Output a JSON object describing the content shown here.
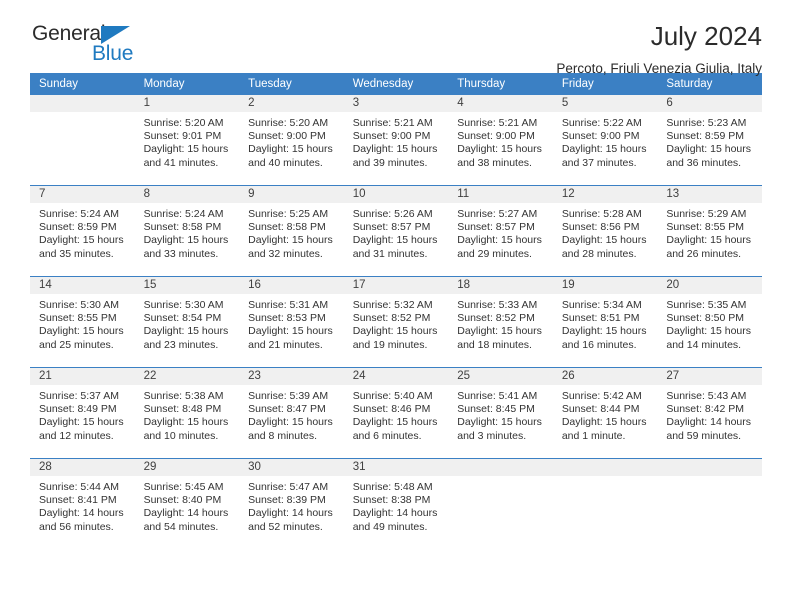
{
  "brand": {
    "word_general": "General",
    "word_blue": "Blue",
    "accent_color": "#1f7ac0"
  },
  "header": {
    "title": "July 2024",
    "subtitle": "Percoto, Friuli Venezia Giulia, Italy",
    "header_bg_color": "#3b80c4",
    "daynum_bg_color": "#f0f0f0"
  },
  "weekday_headers": [
    "Sunday",
    "Monday",
    "Tuesday",
    "Wednesday",
    "Thursday",
    "Friday",
    "Saturday"
  ],
  "weeks": [
    [
      {
        "day": "",
        "sunrise": "",
        "sunset": "",
        "daylight_line1": "",
        "daylight_line2": ""
      },
      {
        "day": "1",
        "sunrise": "Sunrise: 5:20 AM",
        "sunset": "Sunset: 9:01 PM",
        "daylight_line1": "Daylight: 15 hours",
        "daylight_line2": "and 41 minutes."
      },
      {
        "day": "2",
        "sunrise": "Sunrise: 5:20 AM",
        "sunset": "Sunset: 9:00 PM",
        "daylight_line1": "Daylight: 15 hours",
        "daylight_line2": "and 40 minutes."
      },
      {
        "day": "3",
        "sunrise": "Sunrise: 5:21 AM",
        "sunset": "Sunset: 9:00 PM",
        "daylight_line1": "Daylight: 15 hours",
        "daylight_line2": "and 39 minutes."
      },
      {
        "day": "4",
        "sunrise": "Sunrise: 5:21 AM",
        "sunset": "Sunset: 9:00 PM",
        "daylight_line1": "Daylight: 15 hours",
        "daylight_line2": "and 38 minutes."
      },
      {
        "day": "5",
        "sunrise": "Sunrise: 5:22 AM",
        "sunset": "Sunset: 9:00 PM",
        "daylight_line1": "Daylight: 15 hours",
        "daylight_line2": "and 37 minutes."
      },
      {
        "day": "6",
        "sunrise": "Sunrise: 5:23 AM",
        "sunset": "Sunset: 8:59 PM",
        "daylight_line1": "Daylight: 15 hours",
        "daylight_line2": "and 36 minutes."
      }
    ],
    [
      {
        "day": "7",
        "sunrise": "Sunrise: 5:24 AM",
        "sunset": "Sunset: 8:59 PM",
        "daylight_line1": "Daylight: 15 hours",
        "daylight_line2": "and 35 minutes."
      },
      {
        "day": "8",
        "sunrise": "Sunrise: 5:24 AM",
        "sunset": "Sunset: 8:58 PM",
        "daylight_line1": "Daylight: 15 hours",
        "daylight_line2": "and 33 minutes."
      },
      {
        "day": "9",
        "sunrise": "Sunrise: 5:25 AM",
        "sunset": "Sunset: 8:58 PM",
        "daylight_line1": "Daylight: 15 hours",
        "daylight_line2": "and 32 minutes."
      },
      {
        "day": "10",
        "sunrise": "Sunrise: 5:26 AM",
        "sunset": "Sunset: 8:57 PM",
        "daylight_line1": "Daylight: 15 hours",
        "daylight_line2": "and 31 minutes."
      },
      {
        "day": "11",
        "sunrise": "Sunrise: 5:27 AM",
        "sunset": "Sunset: 8:57 PM",
        "daylight_line1": "Daylight: 15 hours",
        "daylight_line2": "and 29 minutes."
      },
      {
        "day": "12",
        "sunrise": "Sunrise: 5:28 AM",
        "sunset": "Sunset: 8:56 PM",
        "daylight_line1": "Daylight: 15 hours",
        "daylight_line2": "and 28 minutes."
      },
      {
        "day": "13",
        "sunrise": "Sunrise: 5:29 AM",
        "sunset": "Sunset: 8:55 PM",
        "daylight_line1": "Daylight: 15 hours",
        "daylight_line2": "and 26 minutes."
      }
    ],
    [
      {
        "day": "14",
        "sunrise": "Sunrise: 5:30 AM",
        "sunset": "Sunset: 8:55 PM",
        "daylight_line1": "Daylight: 15 hours",
        "daylight_line2": "and 25 minutes."
      },
      {
        "day": "15",
        "sunrise": "Sunrise: 5:30 AM",
        "sunset": "Sunset: 8:54 PM",
        "daylight_line1": "Daylight: 15 hours",
        "daylight_line2": "and 23 minutes."
      },
      {
        "day": "16",
        "sunrise": "Sunrise: 5:31 AM",
        "sunset": "Sunset: 8:53 PM",
        "daylight_line1": "Daylight: 15 hours",
        "daylight_line2": "and 21 minutes."
      },
      {
        "day": "17",
        "sunrise": "Sunrise: 5:32 AM",
        "sunset": "Sunset: 8:52 PM",
        "daylight_line1": "Daylight: 15 hours",
        "daylight_line2": "and 19 minutes."
      },
      {
        "day": "18",
        "sunrise": "Sunrise: 5:33 AM",
        "sunset": "Sunset: 8:52 PM",
        "daylight_line1": "Daylight: 15 hours",
        "daylight_line2": "and 18 minutes."
      },
      {
        "day": "19",
        "sunrise": "Sunrise: 5:34 AM",
        "sunset": "Sunset: 8:51 PM",
        "daylight_line1": "Daylight: 15 hours",
        "daylight_line2": "and 16 minutes."
      },
      {
        "day": "20",
        "sunrise": "Sunrise: 5:35 AM",
        "sunset": "Sunset: 8:50 PM",
        "daylight_line1": "Daylight: 15 hours",
        "daylight_line2": "and 14 minutes."
      }
    ],
    [
      {
        "day": "21",
        "sunrise": "Sunrise: 5:37 AM",
        "sunset": "Sunset: 8:49 PM",
        "daylight_line1": "Daylight: 15 hours",
        "daylight_line2": "and 12 minutes."
      },
      {
        "day": "22",
        "sunrise": "Sunrise: 5:38 AM",
        "sunset": "Sunset: 8:48 PM",
        "daylight_line1": "Daylight: 15 hours",
        "daylight_line2": "and 10 minutes."
      },
      {
        "day": "23",
        "sunrise": "Sunrise: 5:39 AM",
        "sunset": "Sunset: 8:47 PM",
        "daylight_line1": "Daylight: 15 hours",
        "daylight_line2": "and 8 minutes."
      },
      {
        "day": "24",
        "sunrise": "Sunrise: 5:40 AM",
        "sunset": "Sunset: 8:46 PM",
        "daylight_line1": "Daylight: 15 hours",
        "daylight_line2": "and 6 minutes."
      },
      {
        "day": "25",
        "sunrise": "Sunrise: 5:41 AM",
        "sunset": "Sunset: 8:45 PM",
        "daylight_line1": "Daylight: 15 hours",
        "daylight_line2": "and 3 minutes."
      },
      {
        "day": "26",
        "sunrise": "Sunrise: 5:42 AM",
        "sunset": "Sunset: 8:44 PM",
        "daylight_line1": "Daylight: 15 hours",
        "daylight_line2": "and 1 minute."
      },
      {
        "day": "27",
        "sunrise": "Sunrise: 5:43 AM",
        "sunset": "Sunset: 8:42 PM",
        "daylight_line1": "Daylight: 14 hours",
        "daylight_line2": "and 59 minutes."
      }
    ],
    [
      {
        "day": "28",
        "sunrise": "Sunrise: 5:44 AM",
        "sunset": "Sunset: 8:41 PM",
        "daylight_line1": "Daylight: 14 hours",
        "daylight_line2": "and 56 minutes."
      },
      {
        "day": "29",
        "sunrise": "Sunrise: 5:45 AM",
        "sunset": "Sunset: 8:40 PM",
        "daylight_line1": "Daylight: 14 hours",
        "daylight_line2": "and 54 minutes."
      },
      {
        "day": "30",
        "sunrise": "Sunrise: 5:47 AM",
        "sunset": "Sunset: 8:39 PM",
        "daylight_line1": "Daylight: 14 hours",
        "daylight_line2": "and 52 minutes."
      },
      {
        "day": "31",
        "sunrise": "Sunrise: 5:48 AM",
        "sunset": "Sunset: 8:38 PM",
        "daylight_line1": "Daylight: 14 hours",
        "daylight_line2": "and 49 minutes."
      },
      {
        "day": "",
        "sunrise": "",
        "sunset": "",
        "daylight_line1": "",
        "daylight_line2": ""
      },
      {
        "day": "",
        "sunrise": "",
        "sunset": "",
        "daylight_line1": "",
        "daylight_line2": ""
      },
      {
        "day": "",
        "sunrise": "",
        "sunset": "",
        "daylight_line1": "",
        "daylight_line2": ""
      }
    ]
  ]
}
